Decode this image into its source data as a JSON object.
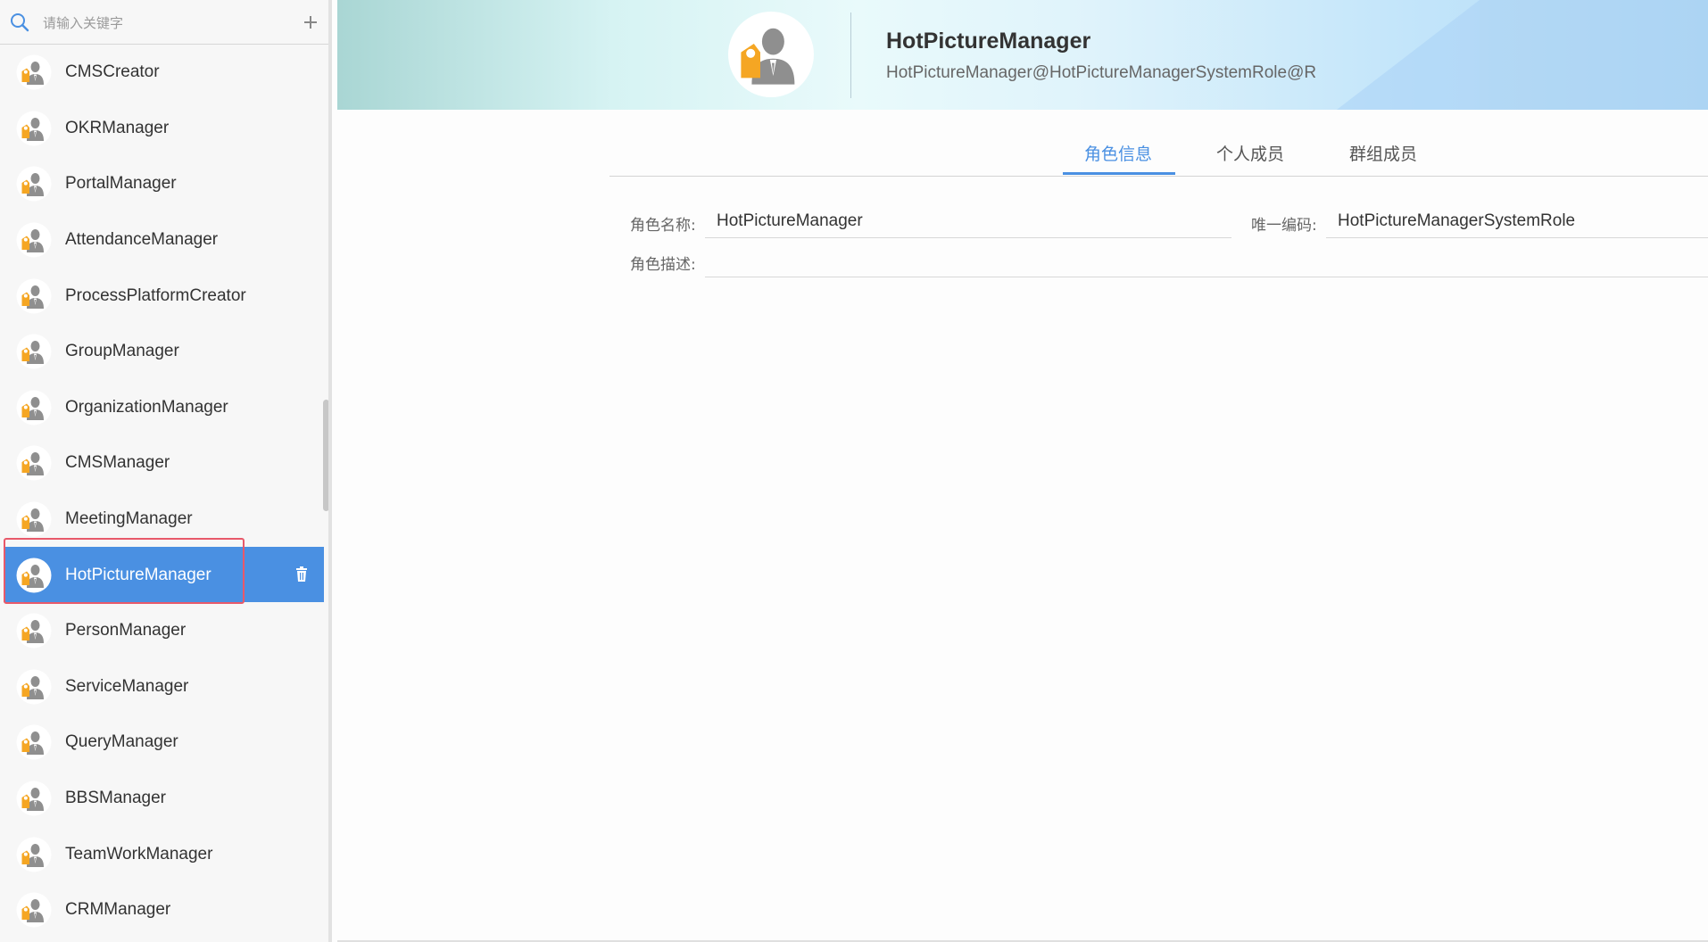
{
  "search": {
    "placeholder": "请输入关键字"
  },
  "roles": [
    {
      "name": "CMSCreator"
    },
    {
      "name": "OKRManager"
    },
    {
      "name": "PortalManager"
    },
    {
      "name": "AttendanceManager"
    },
    {
      "name": "ProcessPlatformCreator"
    },
    {
      "name": "GroupManager"
    },
    {
      "name": "OrganizationManager"
    },
    {
      "name": "CMSManager"
    },
    {
      "name": "MeetingManager"
    },
    {
      "name": "HotPictureManager",
      "selected": true
    },
    {
      "name": "PersonManager"
    },
    {
      "name": "ServiceManager"
    },
    {
      "name": "QueryManager"
    },
    {
      "name": "BBSManager"
    },
    {
      "name": "TeamWorkManager"
    },
    {
      "name": "CRMManager"
    }
  ],
  "header": {
    "title": "HotPictureManager",
    "subtitle": "HotPictureManager@HotPictureManagerSystemRole@R"
  },
  "tabs": [
    {
      "label": "角色信息",
      "active": true
    },
    {
      "label": "个人成员",
      "active": false
    },
    {
      "label": "群组成员",
      "active": false
    }
  ],
  "form": {
    "name_label": "角色名称:",
    "name_value": "HotPictureManager",
    "code_label": "唯一编码:",
    "code_value": "HotPictureManagerSystemRole",
    "desc_label": "角色描述:",
    "desc_value": ""
  },
  "colors": {
    "accent": "#4a90e2",
    "selection_outline": "#e8596a",
    "role_icon_orange": "#f5a623",
    "role_icon_gray": "#8f8f8f"
  },
  "icons": {
    "search": "search-icon",
    "add": "plus-icon",
    "delete": "trash-icon",
    "role": "role-avatar-icon"
  }
}
